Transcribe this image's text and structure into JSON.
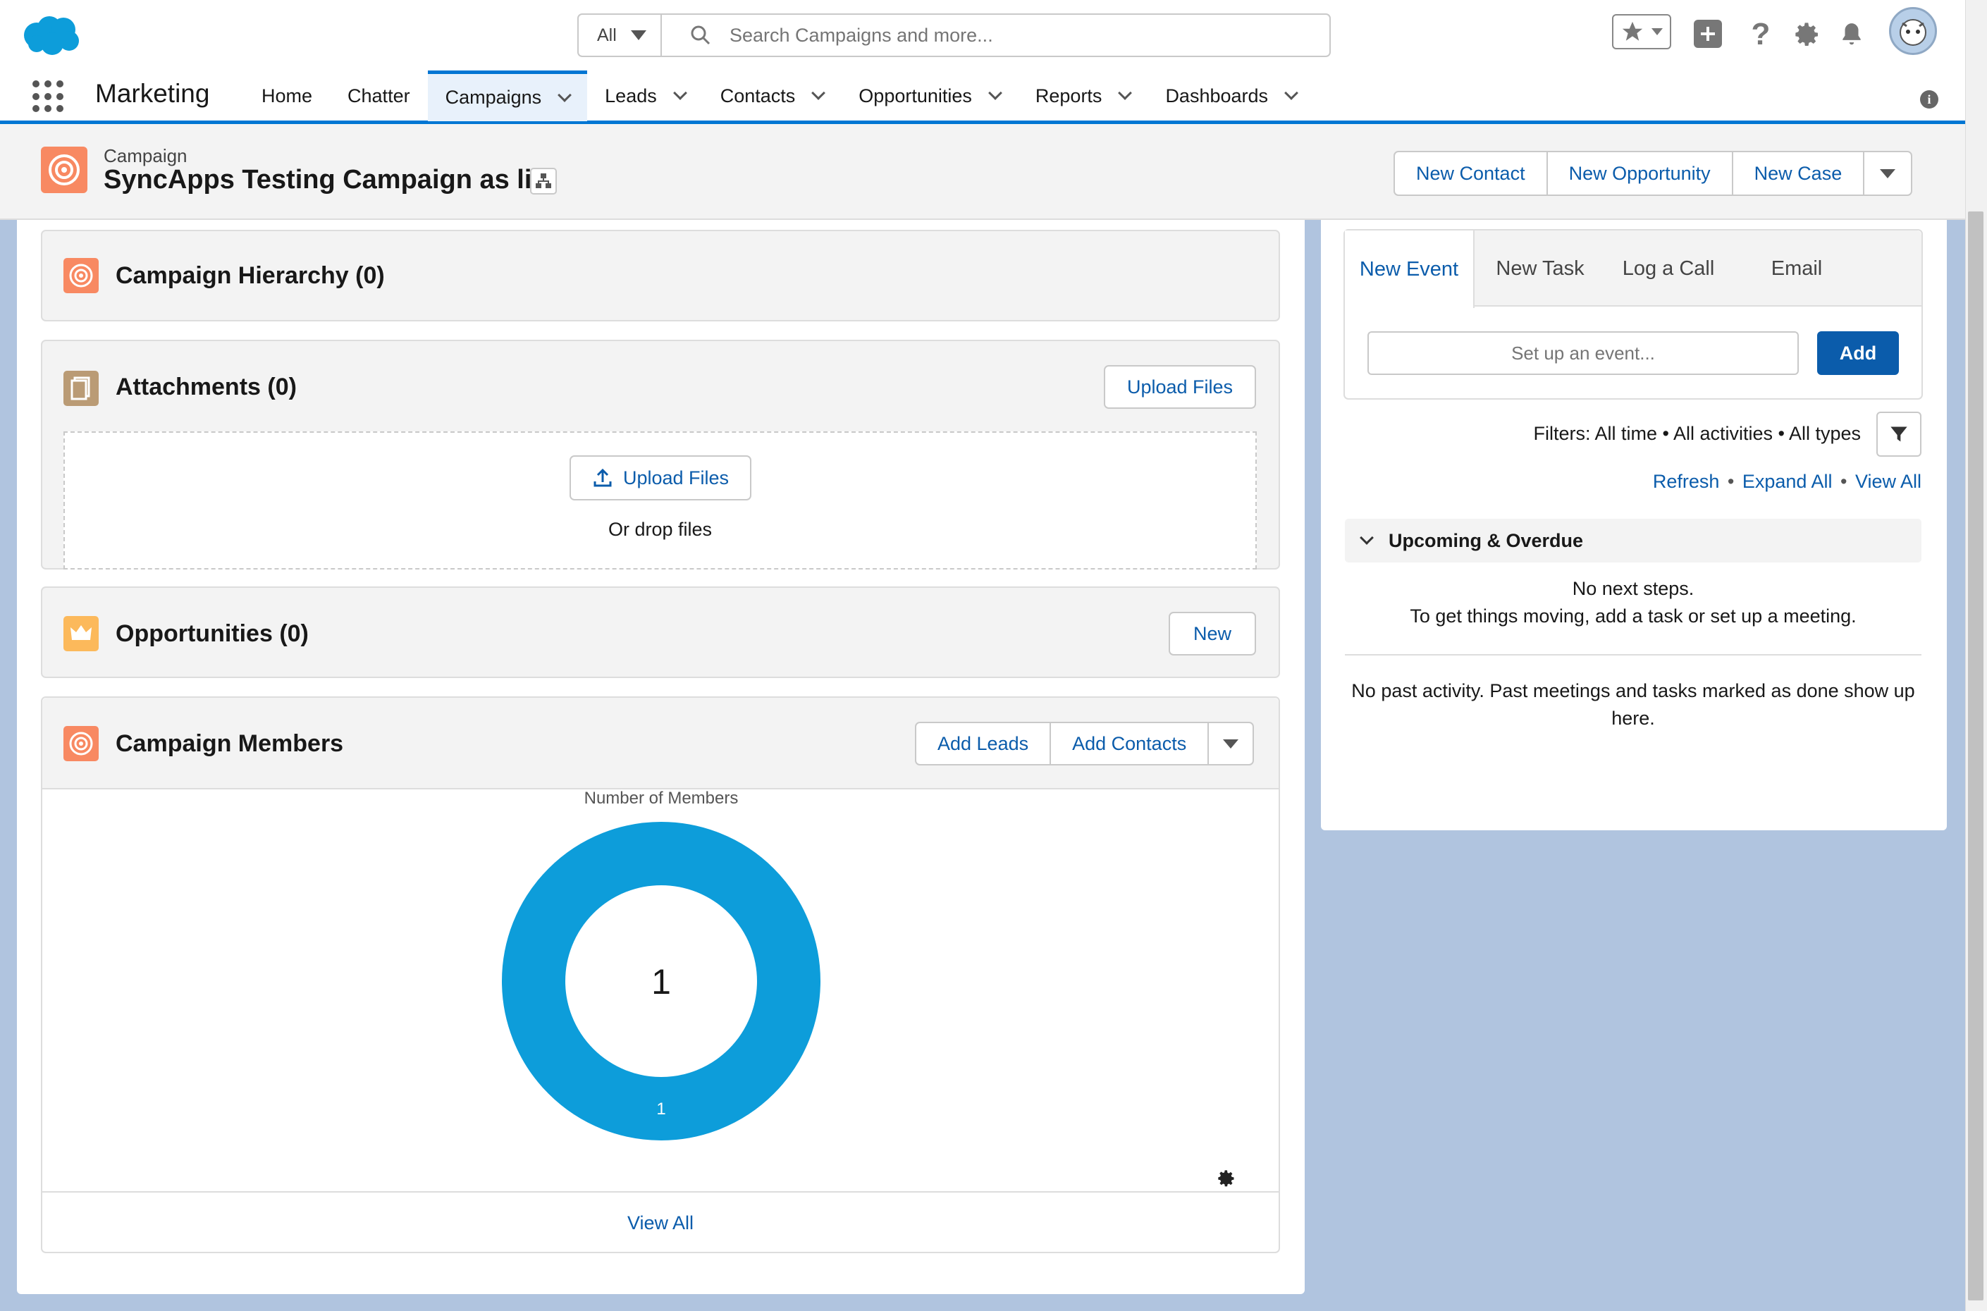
{
  "header": {
    "search_scope": "All",
    "search_placeholder": "Search Campaigns and more...",
    "app_name": "Marketing"
  },
  "nav": {
    "items": [
      {
        "label": "Home",
        "has_menu": false
      },
      {
        "label": "Chatter",
        "has_menu": false
      },
      {
        "label": "Campaigns",
        "has_menu": true,
        "active": true
      },
      {
        "label": "Leads",
        "has_menu": true
      },
      {
        "label": "Contacts",
        "has_menu": true
      },
      {
        "label": "Opportunities",
        "has_menu": true
      },
      {
        "label": "Reports",
        "has_menu": true
      },
      {
        "label": "Dashboards",
        "has_menu": true
      }
    ]
  },
  "record": {
    "type_label": "Campaign",
    "title": "SyncApps Testing Campaign as list",
    "actions": [
      "New Contact",
      "New Opportunity",
      "New Case"
    ]
  },
  "related": {
    "hierarchy_title": "Campaign Hierarchy (0)",
    "attachments_title": "Attachments (0)",
    "upload_files": "Upload Files",
    "upload_files_inner": "Upload Files",
    "drop_files": "Or drop files",
    "opportunities_title": "Opportunities (0)",
    "new_label": "New",
    "members_title": "Campaign Members",
    "add_leads": "Add Leads",
    "add_contacts": "Add Contacts",
    "view_all": "View All"
  },
  "chart_data": {
    "type": "pie",
    "title": "Number of Members",
    "center_total": "1",
    "categories": [
      ""
    ],
    "values": [
      1
    ],
    "slice_labels": [
      "1"
    ],
    "colors": [
      "#0d9dda"
    ]
  },
  "activity": {
    "tabs": [
      "New Event",
      "New Task",
      "Log a Call",
      "Email"
    ],
    "event_placeholder": "Set up an event...",
    "add_label": "Add",
    "filters_text": "Filters: All time • All activities • All types",
    "links": [
      "Refresh",
      "Expand All",
      "View All"
    ],
    "upcoming_title": "Upcoming & Overdue",
    "no_next_1": "No next steps.",
    "no_next_2": "To get things moving, add a task or set up a meeting.",
    "no_past_1": "No past activity. Past meetings and tasks marked as done show up",
    "no_past_2": "here."
  },
  "colors": {
    "brand": "#0176d3",
    "link": "#0b5cab",
    "campaign_icon": "#f88962",
    "attachment_icon": "#ba9b75",
    "opportunity_icon": "#fcb95b",
    "chart_blue": "#0d9dda"
  }
}
